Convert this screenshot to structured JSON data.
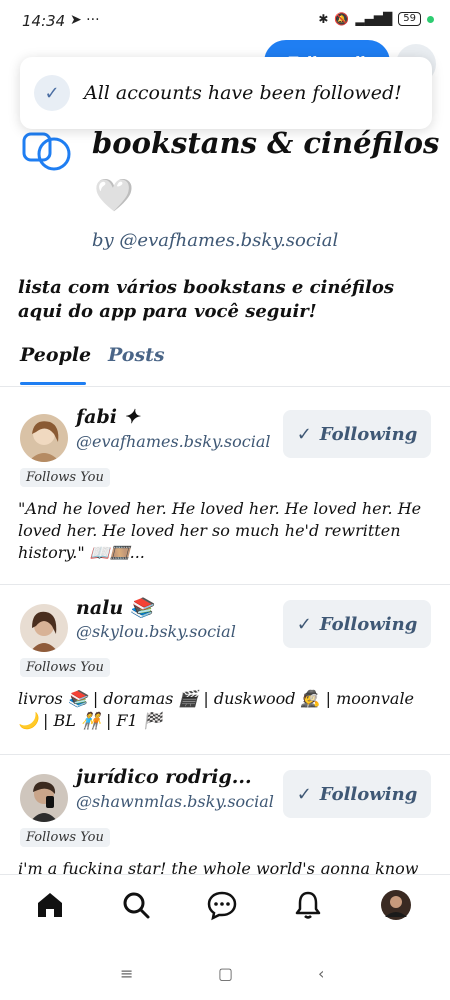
{
  "status_bar": {
    "time": "14:34",
    "left_icons": "➤ ···",
    "battery": "59"
  },
  "header": {
    "follow_button_label": "Follow all"
  },
  "toast": {
    "message": "All accounts have been followed!"
  },
  "list": {
    "title": "bookstans & cinéfilos",
    "emoji": "🤍",
    "author": "by @evafhames.bsky.social",
    "description": "lista com vários bookstans e cinéfilos aqui do app para você seguir!"
  },
  "tabs": [
    {
      "label": "People",
      "active": true
    },
    {
      "label": "Posts",
      "active": false
    }
  ],
  "users": [
    {
      "name": "fabi ✦",
      "handle": "@evafhames.bsky.social",
      "follow_label": "Following",
      "badge": "Follows You",
      "bio": "\"And he loved her. He loved her. He loved her. He loved her. He loved her so much he'd rewritten history.\" 📖🎞️..."
    },
    {
      "name": "nalu 📚",
      "handle": "@skylou.bsky.social",
      "follow_label": "Following",
      "badge": "Follows You",
      "bio": "livros 📚 | doramas 🎬 | duskwood 🕵️ | moonvale 🌙 | BL 🧑‍🤝‍🧑 | F1 🏁"
    },
    {
      "name": "jurídico rodrig...",
      "handle": "@shawnmlas.bsky.social",
      "follow_label": "Following",
      "badge": "Follows You",
      "bio": "i'm a fucking star! the whole world's gonna know"
    }
  ],
  "bottom_nav": [
    {
      "icon": "home-icon"
    },
    {
      "icon": "search-icon"
    },
    {
      "icon": "chat-icon"
    },
    {
      "icon": "bell-icon"
    },
    {
      "icon": "profile-avatar"
    }
  ],
  "colors": {
    "accent": "#1f7ef2",
    "muted_blue": "#3f5875",
    "button_bg": "#eef1f4"
  }
}
